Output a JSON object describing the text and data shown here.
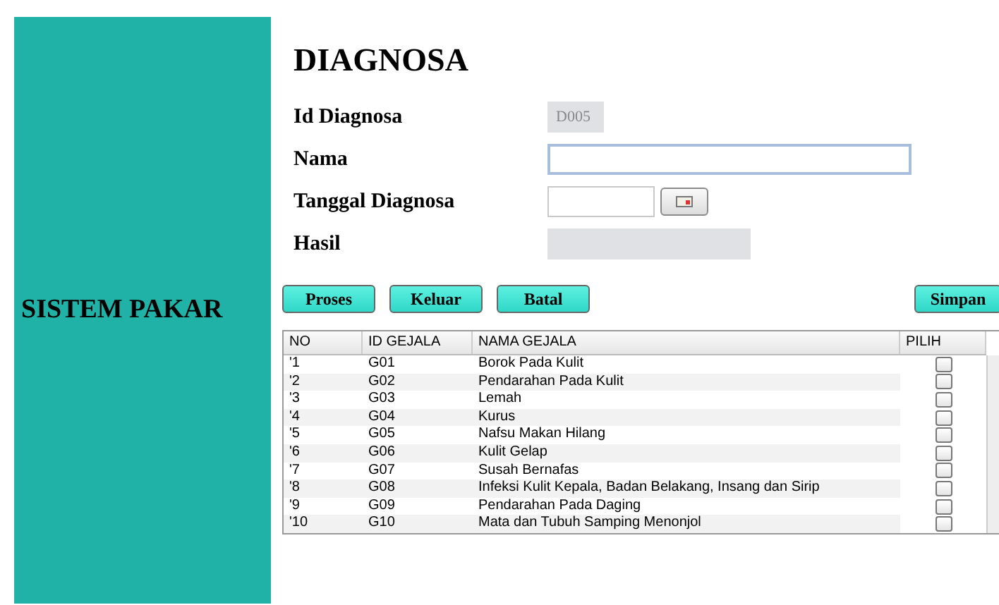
{
  "sidebar": {
    "title": "SISTEM PAKAR"
  },
  "form": {
    "title": "DIAGNOSA",
    "fields": [
      {
        "label": "Id Diagnosa",
        "kind": "readonly",
        "value": "D005"
      },
      {
        "label": "Nama",
        "kind": "text"
      },
      {
        "label": "Tanggal Diagnosa",
        "kind": "date"
      },
      {
        "label": "Hasil",
        "kind": "output"
      }
    ]
  },
  "buttons": [
    {
      "label": "Proses"
    },
    {
      "label": "Keluar"
    },
    {
      "label": "Batal"
    },
    {
      "label": "Simpan"
    }
  ],
  "table": {
    "columns": [
      "NO",
      "ID GEJALA",
      "NAMA GEJALA",
      "PILIH"
    ],
    "rows": [
      {
        "no": "'1",
        "id": "G01",
        "name": "Borok Pada Kulit",
        "checked": false
      },
      {
        "no": "'2",
        "id": "G02",
        "name": "Pendarahan Pada Kulit",
        "checked": false
      },
      {
        "no": "'3",
        "id": "G03",
        "name": "Lemah",
        "checked": false
      },
      {
        "no": "'4",
        "id": "G04",
        "name": "Kurus",
        "checked": false
      },
      {
        "no": "'5",
        "id": "G05",
        "name": "Nafsu Makan Hilang",
        "checked": false
      },
      {
        "no": "'6",
        "id": "G06",
        "name": "Kulit Gelap",
        "checked": false
      },
      {
        "no": "'7",
        "id": "G07",
        "name": "Susah Bernafas",
        "checked": false
      },
      {
        "no": "'8",
        "id": "G08",
        "name": "Infeksi Kulit Kepala, Badan Belakang, Insang dan Sirip",
        "checked": false
      },
      {
        "no": "'9",
        "id": "G09",
        "name": "Pendarahan Pada Daging",
        "checked": false
      },
      {
        "no": "'10",
        "id": "G10",
        "name": "Mata dan Tubuh Samping Menonjol",
        "checked": false
      }
    ]
  }
}
